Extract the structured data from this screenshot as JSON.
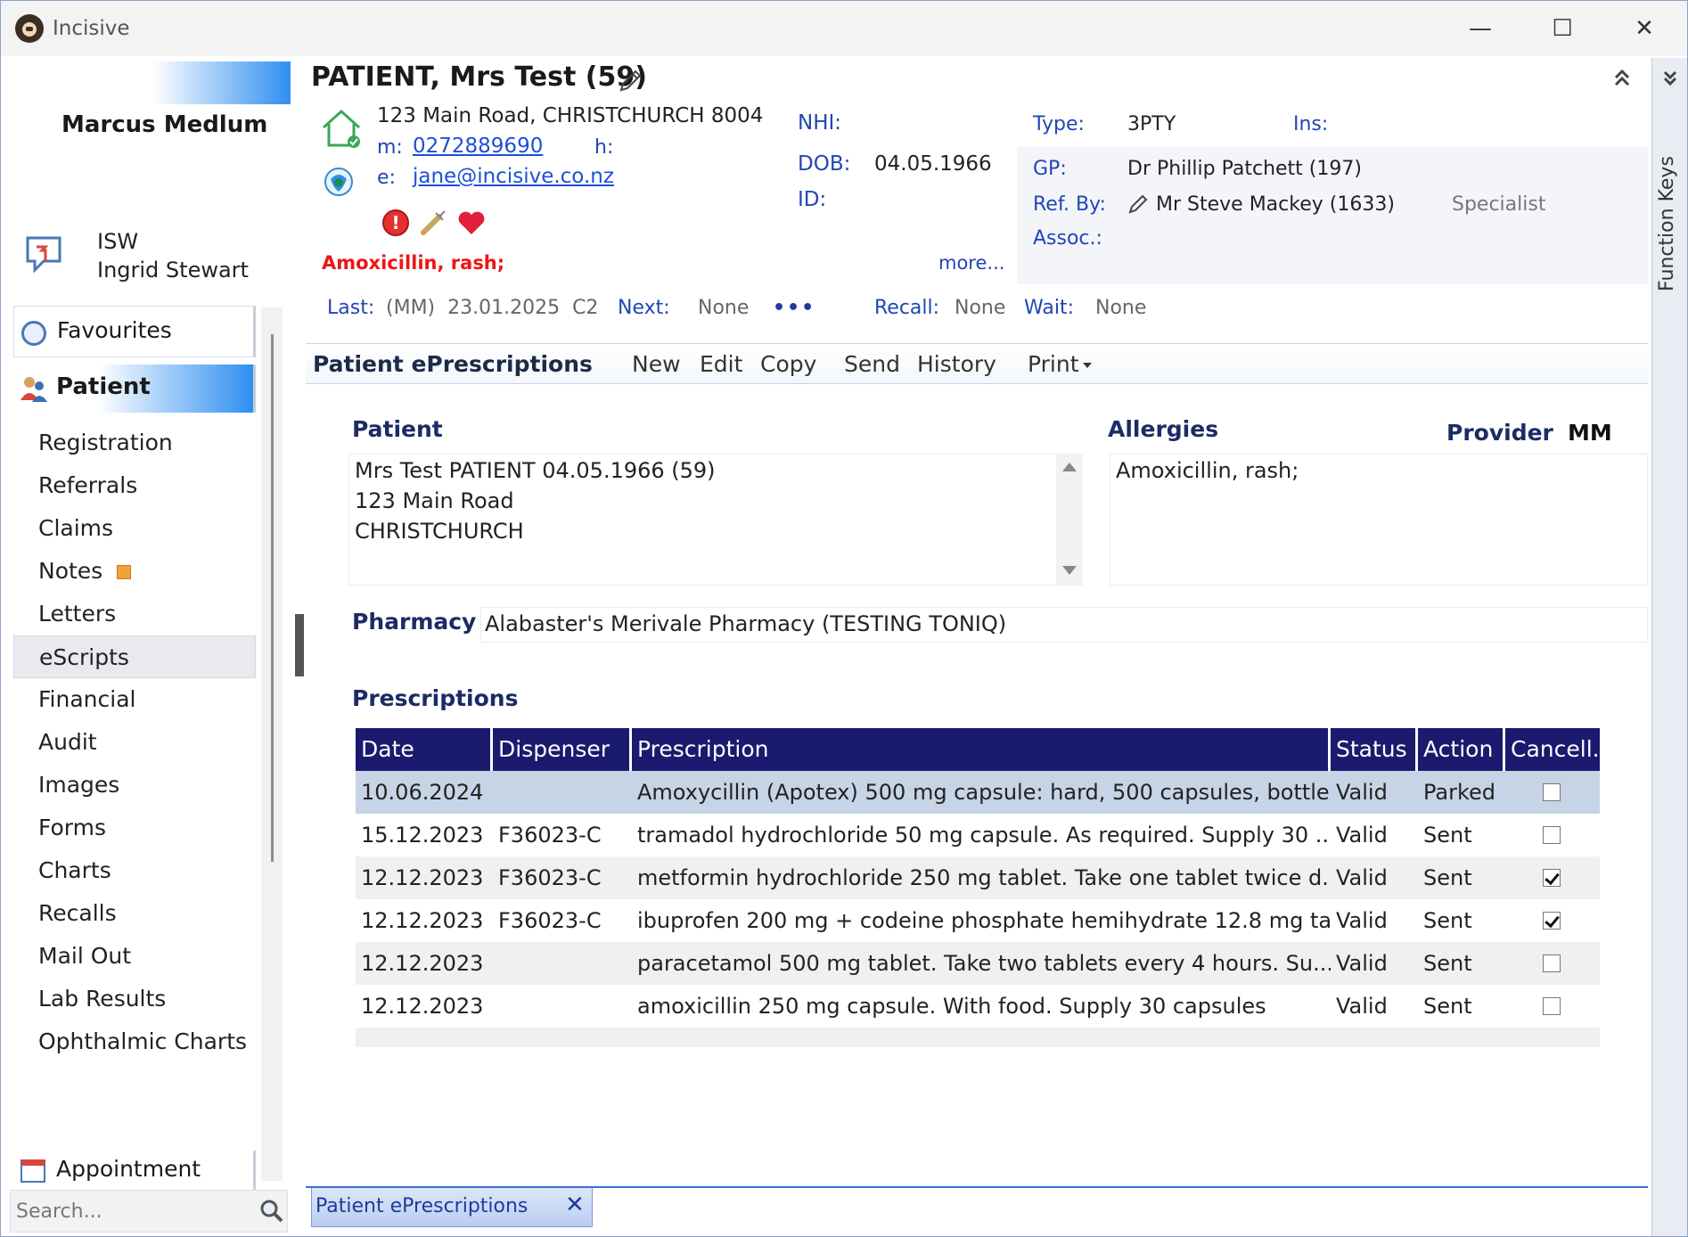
{
  "window": {
    "title": "Incisive",
    "minimize": "—",
    "maximize": "☐",
    "close": "✕"
  },
  "sidebar": {
    "user_name": "Marcus Medlum",
    "message": {
      "line1": "ISW",
      "line2": "Ingrid Stewart"
    },
    "favourites": "Favourites",
    "patient": "Patient",
    "items": [
      {
        "label": "Registration"
      },
      {
        "label": "Referrals"
      },
      {
        "label": "Claims"
      },
      {
        "label": "Notes"
      },
      {
        "label": "Letters"
      },
      {
        "label": "eScripts"
      },
      {
        "label": "Financial"
      },
      {
        "label": "Audit"
      },
      {
        "label": "Images"
      },
      {
        "label": "Forms"
      },
      {
        "label": "Charts"
      },
      {
        "label": "Recalls"
      },
      {
        "label": "Mail Out"
      },
      {
        "label": "Lab Results"
      },
      {
        "label": "Ophthalmic Charts"
      }
    ],
    "appointment": "Appointment",
    "search_placeholder": "Search..."
  },
  "header": {
    "title": "PATIENT, Mrs Test (59)",
    "address": "123 Main Road, CHRISTCHURCH 8004",
    "m_label": "m:",
    "mobile": "0272889690",
    "h_label": "h:",
    "e_label": "e:",
    "email": "jane@incisive.co.nz",
    "alert_glyph": "!",
    "allergy_warning": "Amoxicillin, rash;",
    "nhi_label": "NHI:",
    "dob_label": "DOB:",
    "dob": "04.05.1966",
    "id_label": "ID:",
    "more": "more...",
    "type_label": "Type:",
    "type": "3PTY",
    "ins_label": "Ins:",
    "gp_label": "GP:",
    "gp": "Dr Phillip Patchett (197)",
    "ref_label": "Ref. By:",
    "ref": "Mr Steve Mackey (1633)",
    "ref_type": "Specialist",
    "assoc_label": "Assoc.:",
    "visits": {
      "last_label": "Last:",
      "last": "(MM)  23.01.2025  C2",
      "next_label": "Next:",
      "next": "None",
      "dots": "•••",
      "recall_label": "Recall:",
      "recall": "None",
      "wait_label": "Wait:",
      "wait": "None"
    }
  },
  "function_keys": "Function Keys",
  "toolbar": {
    "title": "Patient ePrescriptions",
    "new": "New",
    "edit": "Edit",
    "copy": "Copy",
    "send": "Send",
    "history": "History",
    "print": "Print"
  },
  "patient_section": {
    "title": "Patient",
    "lines": [
      "Mrs Test PATIENT 04.05.1966 (59)",
      "123 Main Road",
      "CHRISTCHURCH"
    ]
  },
  "allergies_section": {
    "title": "Allergies",
    "text": "Amoxicillin, rash;",
    "provider_label": "Provider",
    "provider": "MM"
  },
  "pharmacy": {
    "label": "Pharmacy",
    "value": "Alabaster's Merivale Pharmacy (TESTING TONIQ)"
  },
  "prescriptions": {
    "title": "Prescriptions",
    "columns": [
      "Date",
      "Dispenser",
      "Prescription",
      "Status",
      "Action",
      "Cancell..."
    ],
    "rows": [
      {
        "date": "10.06.2024",
        "dispenser": "",
        "prescription": "Amoxycillin (Apotex) 500 mg capsule: hard, 500 capsules, bottle. ...",
        "status": "Valid",
        "action": "Parked",
        "cancelled": false
      },
      {
        "date": "15.12.2023",
        "dispenser": "F36023-C",
        "prescription": "tramadol hydrochloride 50 mg capsule.  As required.  Supply 30 ...",
        "status": "Valid",
        "action": "Sent",
        "cancelled": false
      },
      {
        "date": "12.12.2023",
        "dispenser": "F36023-C",
        "prescription": "metformin hydrochloride 250 mg tablet.  Take one tablet twice d...",
        "status": "Valid",
        "action": "Sent",
        "cancelled": true
      },
      {
        "date": "12.12.2023",
        "dispenser": "F36023-C",
        "prescription": "ibuprofen 200 mg + codeine phosphate hemihydrate 12.8 mg ta...",
        "status": "Valid",
        "action": "Sent",
        "cancelled": true
      },
      {
        "date": "12.12.2023",
        "dispenser": "",
        "prescription": "paracetamol 500 mg tablet.  Take two tablets every 4 hours.  Su...",
        "status": "Valid",
        "action": "Sent",
        "cancelled": false
      },
      {
        "date": "12.12.2023",
        "dispenser": "",
        "prescription": "amoxicillin 250 mg capsule.  With food.  Supply 30 capsules",
        "status": "Valid",
        "action": "Sent",
        "cancelled": false
      }
    ]
  },
  "bottom_tab": {
    "label": "Patient ePrescriptions",
    "close": "✕"
  }
}
